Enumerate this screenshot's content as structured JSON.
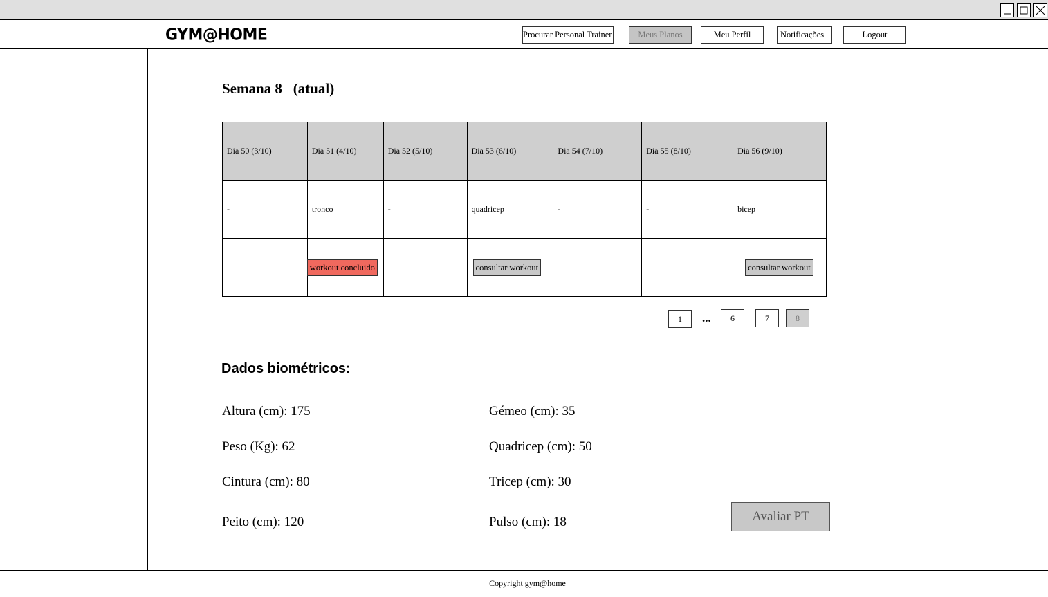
{
  "app": {
    "logo": "GYM@HOME"
  },
  "window_controls": [
    "minimize-icon",
    "maximize-icon",
    "close-icon"
  ],
  "nav": {
    "items": [
      {
        "label": "Procurar Personal Trainer",
        "active": false
      },
      {
        "label": "Meus Planos",
        "active": true
      },
      {
        "label": "Meu Perfil",
        "active": false
      },
      {
        "label": "Notificações",
        "active": false
      },
      {
        "label": "Logout",
        "active": false
      }
    ]
  },
  "week": {
    "title": "Semana 8",
    "status": "(atual)"
  },
  "schedule": {
    "days": [
      {
        "header": "Dia 50 (3/10)",
        "workout": "-",
        "action": ""
      },
      {
        "header": "Dia 51 (4/10)",
        "workout": "tronco",
        "action": "workout concluido"
      },
      {
        "header": "Dia 52 (5/10)",
        "workout": "-",
        "action": ""
      },
      {
        "header": "Dia 53 (6/10)",
        "workout": "quadricep",
        "action": "consultar workout"
      },
      {
        "header": "Dia 54 (7/10)",
        "workout": "-",
        "action": ""
      },
      {
        "header": "Dia 55 (8/10)",
        "workout": "-",
        "action": ""
      },
      {
        "header": "Dia 56 (9/10)",
        "workout": "bicep",
        "action": "consultar workout"
      }
    ]
  },
  "pagination": {
    "pages": [
      "1",
      "...",
      "6",
      "7",
      "8"
    ],
    "current": "8"
  },
  "biometrics": {
    "title": "Dados biométricos:",
    "left": [
      "Altura (cm): 175",
      "Peso (Kg): 62",
      "Cintura (cm): 80",
      "Peito (cm): 120"
    ],
    "right": [
      "Gémeo (cm): 35",
      "Quadricep (cm): 50",
      "Tricep (cm): 30",
      "Pulso (cm): 18"
    ]
  },
  "rate_button": "Avaliar PT",
  "footer": "Copyright gym@home",
  "colors": {
    "completed": "#f0695e",
    "header_bg": "#cfcfcf",
    "button_gray": "#c8c8c8"
  }
}
